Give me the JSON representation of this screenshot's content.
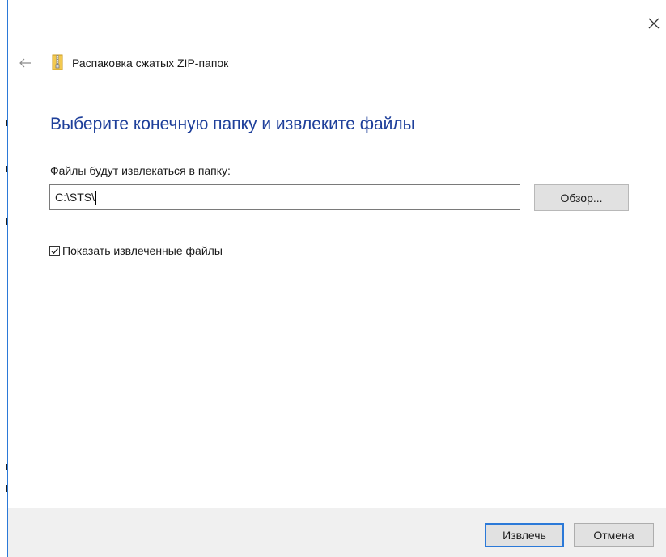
{
  "dialog": {
    "title": "Распаковка сжатых ZIP-папок",
    "instruction": "Выберите конечную папку и извлеките файлы",
    "path_label": "Файлы будут извлекаться в папку:",
    "path_value": "C:\\STS\\",
    "browse_label": "Обзор...",
    "show_files_label": "Показать извлеченные файлы",
    "show_files_checked": true
  },
  "footer": {
    "extract_label": "Извлечь",
    "cancel_label": "Отмена"
  },
  "icons": {
    "close": "close-icon",
    "back": "back-arrow-icon",
    "zip_folder": "zip-folder-icon",
    "checkmark": "checkmark-icon"
  },
  "colors": {
    "accent": "#2b79d8",
    "instruction_text": "#1e3f9a",
    "footer_bg": "#f0f0f0",
    "button_bg": "#e1e1e1"
  }
}
